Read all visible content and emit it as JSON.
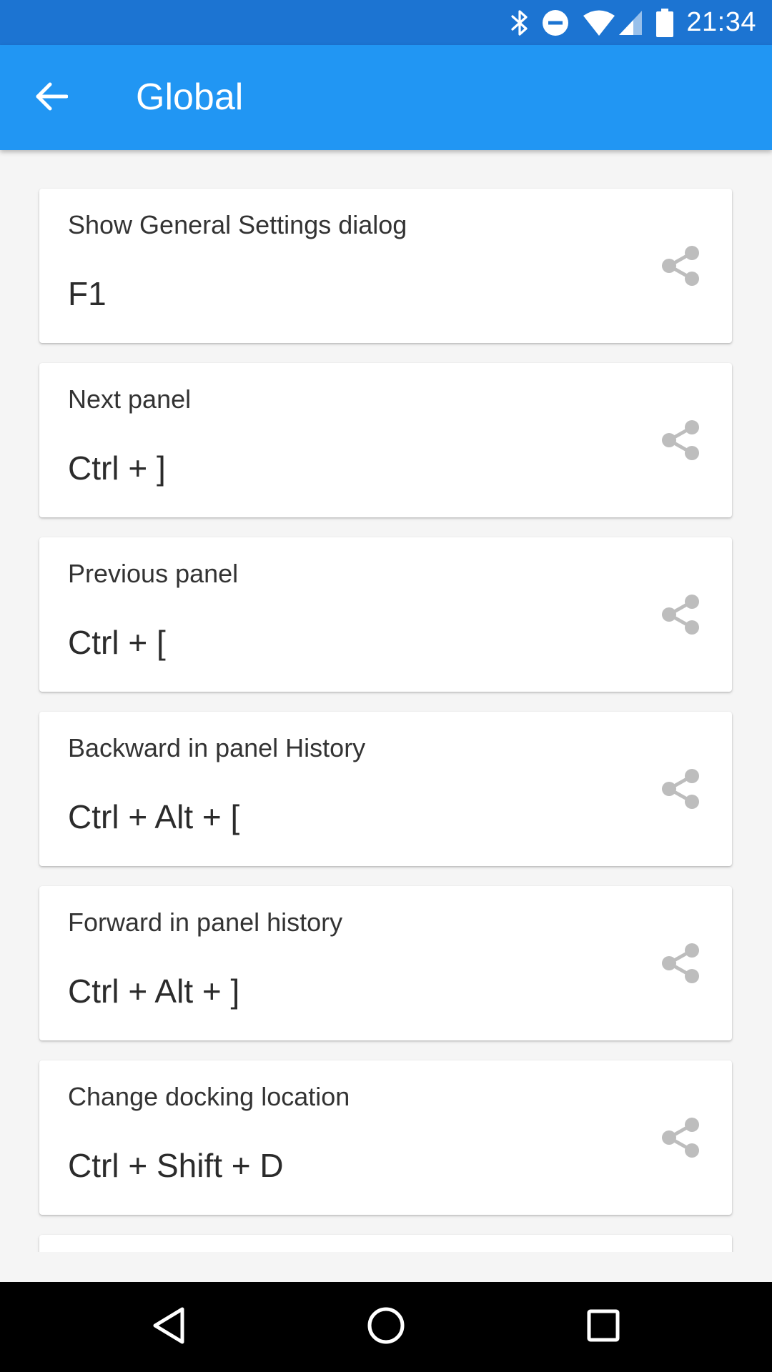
{
  "status_bar": {
    "time": "21:34",
    "icons": [
      "bluetooth-icon",
      "do-not-disturb-icon",
      "wifi-icon",
      "signal-icon",
      "battery-icon"
    ]
  },
  "app_bar": {
    "title": "Global",
    "back_icon": "arrow-back-icon"
  },
  "shortcuts": [
    {
      "label": "Show General Settings dialog",
      "keys": "F1"
    },
    {
      "label": "Next panel",
      "keys": "Ctrl + ]"
    },
    {
      "label": "Previous panel",
      "keys": "Ctrl + ["
    },
    {
      "label": "Backward in panel History",
      "keys": "Ctrl + Alt + ["
    },
    {
      "label": "Forward in panel history",
      "keys": "Ctrl + Alt + ]"
    },
    {
      "label": "Change docking location",
      "keys": "Ctrl + Shift + D"
    }
  ],
  "share_icon": "share-icon",
  "nav_bar": {
    "icons": [
      "back-triangle-icon",
      "home-circle-icon",
      "recents-square-icon"
    ]
  },
  "colors": {
    "status_bar": "#1c74d2",
    "app_bar": "#2196f3",
    "background": "#f5f5f5",
    "card": "#ffffff",
    "share_icon": "#bdbdbd"
  }
}
